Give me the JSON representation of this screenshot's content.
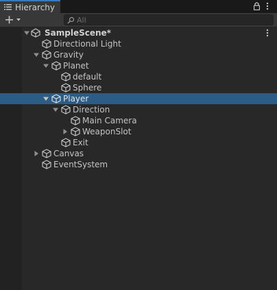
{
  "window": {
    "tab_title": "Hierarchy"
  },
  "toolbar": {
    "search_placeholder": "All"
  },
  "scene": {
    "name": "SampleScene*"
  },
  "objects": [
    {
      "label": "Directional Light"
    },
    {
      "label": "Gravity"
    },
    {
      "label": "Planet"
    },
    {
      "label": "default"
    },
    {
      "label": "Sphere"
    },
    {
      "label": "Player"
    },
    {
      "label": "Direction"
    },
    {
      "label": "Main Camera"
    },
    {
      "label": "WeaponSlot"
    },
    {
      "label": "Exit"
    },
    {
      "label": "Canvas"
    },
    {
      "label": "EventSystem"
    }
  ],
  "colors": {
    "selection": "#2c5d87",
    "tab_accent": "#3a79bb",
    "background": "#282828"
  }
}
